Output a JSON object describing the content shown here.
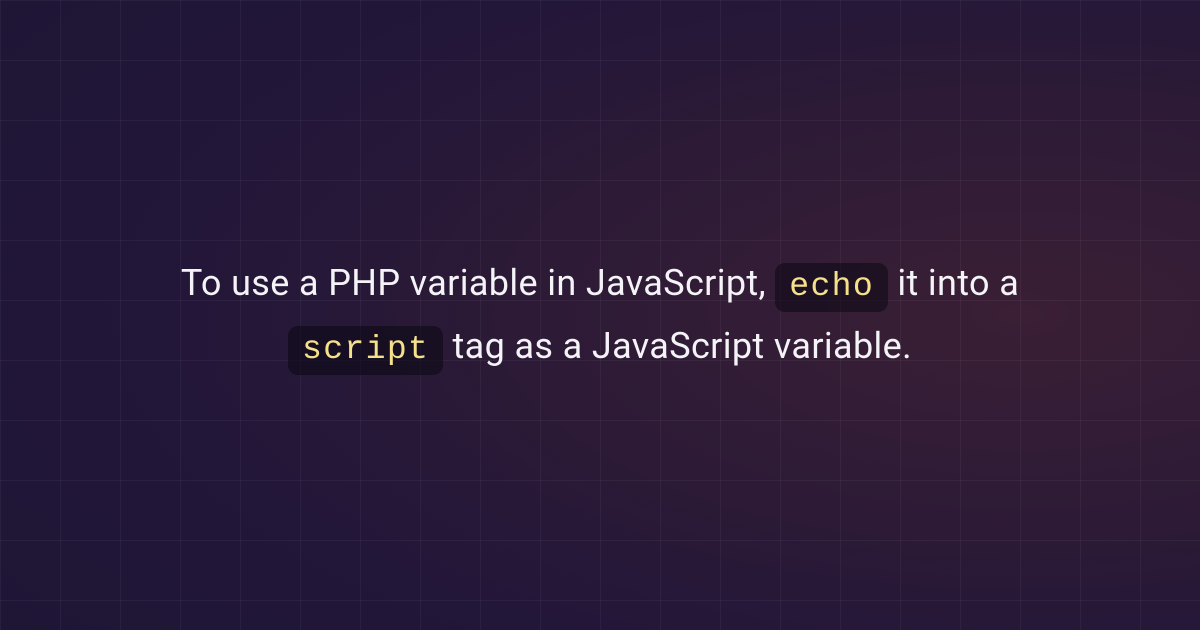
{
  "sentence": {
    "part1": "To use a PHP variable in JavaScript, ",
    "code1": "echo",
    "part2": " it into a ",
    "code2": "script",
    "part3": " tag as a JavaScript variable."
  }
}
